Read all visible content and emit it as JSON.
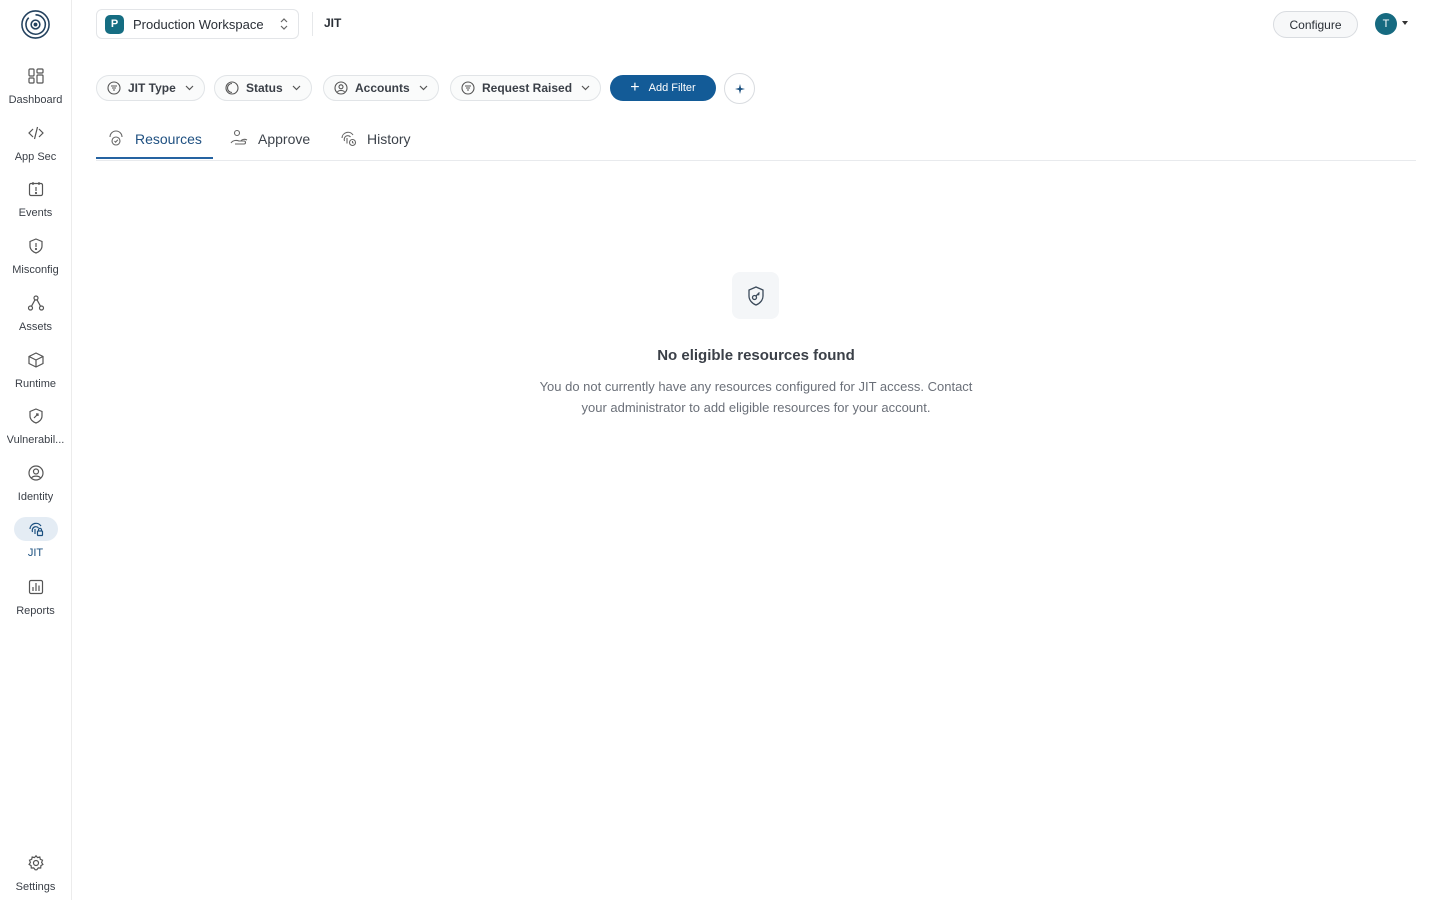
{
  "sidebar": {
    "items": [
      {
        "label": "Dashboard",
        "icon": "dashboard-icon"
      },
      {
        "label": "App Sec",
        "icon": "code-icon"
      },
      {
        "label": "Events",
        "icon": "calendar-alert-icon"
      },
      {
        "label": "Misconfig",
        "icon": "shield-alert-icon"
      },
      {
        "label": "Assets",
        "icon": "nodes-icon"
      },
      {
        "label": "Runtime",
        "icon": "cube-icon"
      },
      {
        "label": "Vulnerabil...",
        "icon": "shield-bug-icon"
      },
      {
        "label": "Identity",
        "icon": "user-circle-icon"
      },
      {
        "label": "JIT",
        "icon": "fingerprint-lock-icon"
      },
      {
        "label": "Reports",
        "icon": "bar-chart-icon"
      }
    ],
    "settings_label": "Settings",
    "active": "JIT"
  },
  "header": {
    "workspace_initial": "P",
    "workspace_name": "Production Workspace",
    "page_title": "JIT",
    "configure_label": "Configure",
    "user_initial": "T"
  },
  "filters": {
    "items": [
      {
        "label": "JIT Type",
        "icon": "filter-lines-icon"
      },
      {
        "label": "Status",
        "icon": "status-circle-icon"
      },
      {
        "label": "Accounts",
        "icon": "user-circle-icon"
      },
      {
        "label": "Request Raised",
        "icon": "filter-lines-icon"
      }
    ],
    "add_filter_label": "Add Filter"
  },
  "tabs": [
    {
      "label": "Resources",
      "icon": "resources-icon",
      "active": true
    },
    {
      "label": "Approve",
      "icon": "approve-hand-icon",
      "active": false
    },
    {
      "label": "History",
      "icon": "history-fingerprint-icon",
      "active": false
    }
  ],
  "empty_state": {
    "icon": "shield-key-icon",
    "title": "No eligible resources found",
    "description": "You do not currently have any resources configured for JIT access. Contact your administrator to add eligible resources for your account."
  },
  "colors": {
    "primary": "#135b97",
    "workspace_badge": "#156d82",
    "active_nav_bg": "#e4ecf4"
  }
}
